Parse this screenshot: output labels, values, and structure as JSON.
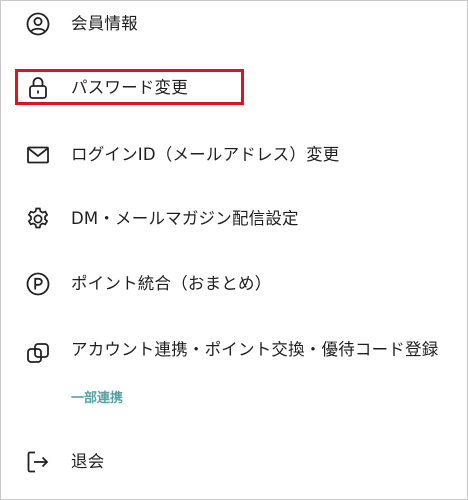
{
  "menu": {
    "items": [
      {
        "label": "会員情報",
        "icon": "user-circle-icon"
      },
      {
        "label": "パスワード変更",
        "icon": "lock-icon"
      },
      {
        "label": "ログインID（メールアドレス）変更",
        "icon": "mail-icon"
      },
      {
        "label": "DM・メールマガジン配信設定",
        "icon": "gear-icon"
      },
      {
        "label": "ポイント統合（おまとめ）",
        "icon": "point-p-icon"
      },
      {
        "label": "アカウント連携・ポイント交換・優待コード登録",
        "icon": "link-accounts-icon",
        "sublabel": "一部連携"
      },
      {
        "label": "退会",
        "icon": "logout-icon"
      }
    ]
  },
  "highlight_color": "#e3101f",
  "sublabel_color": "#5aa0a4"
}
